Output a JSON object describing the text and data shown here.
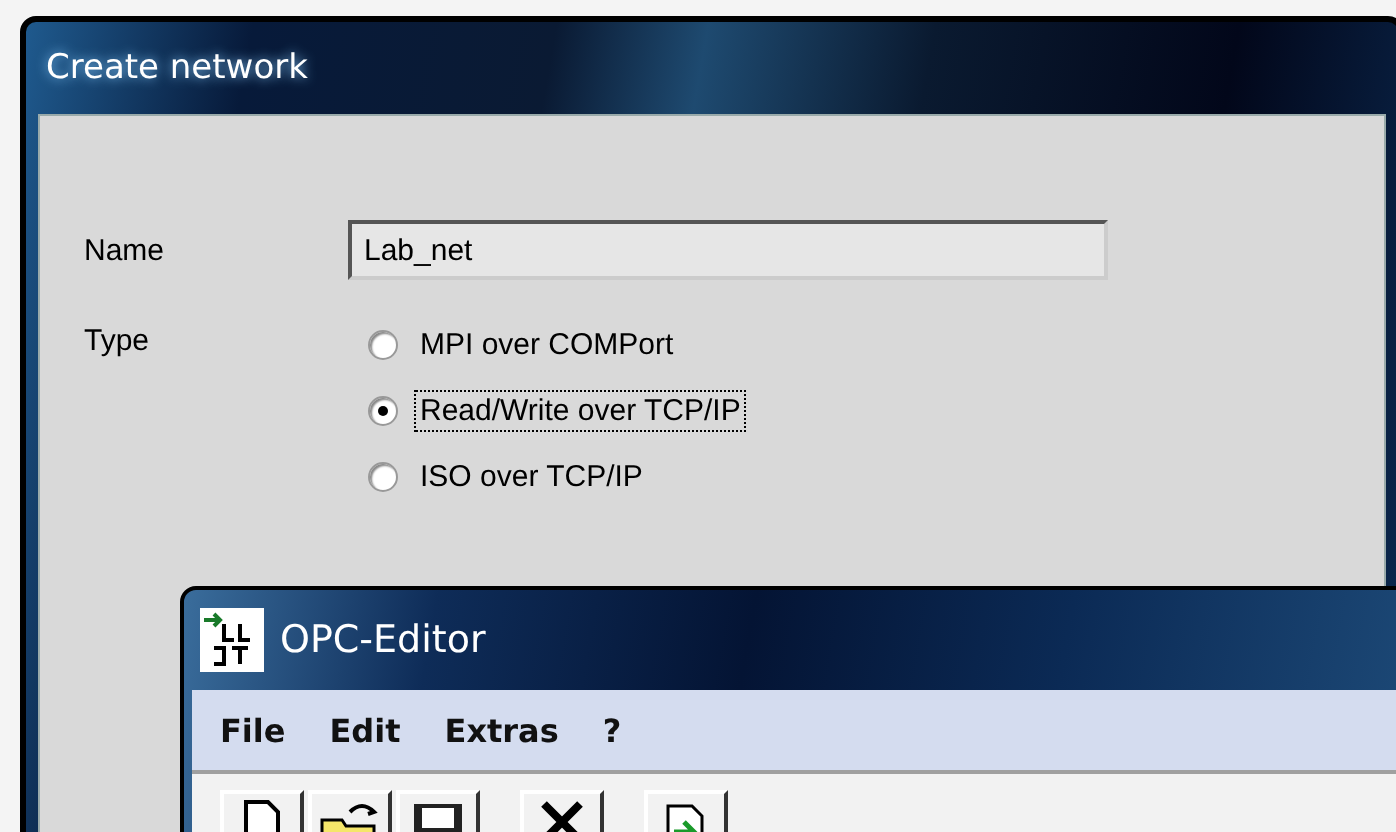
{
  "dialog": {
    "title": "Create network",
    "name_label": "Name",
    "name_value": "Lab_net",
    "type_label": "Type",
    "types": [
      {
        "label": "MPI over COMPort",
        "selected": false,
        "focused": false
      },
      {
        "label": "Read/Write over TCP/IP",
        "selected": true,
        "focused": true
      },
      {
        "label": "ISO over TCP/IP",
        "selected": false,
        "focused": false
      }
    ]
  },
  "editor": {
    "title": "OPC-Editor",
    "menu": [
      "File",
      "Edit",
      "Extras",
      "?"
    ],
    "toolbar": [
      {
        "kind": "new"
      },
      {
        "kind": "open"
      },
      {
        "kind": "save"
      },
      {
        "kind": "gap"
      },
      {
        "kind": "delete"
      },
      {
        "kind": "gap"
      },
      {
        "kind": "export"
      }
    ]
  }
}
